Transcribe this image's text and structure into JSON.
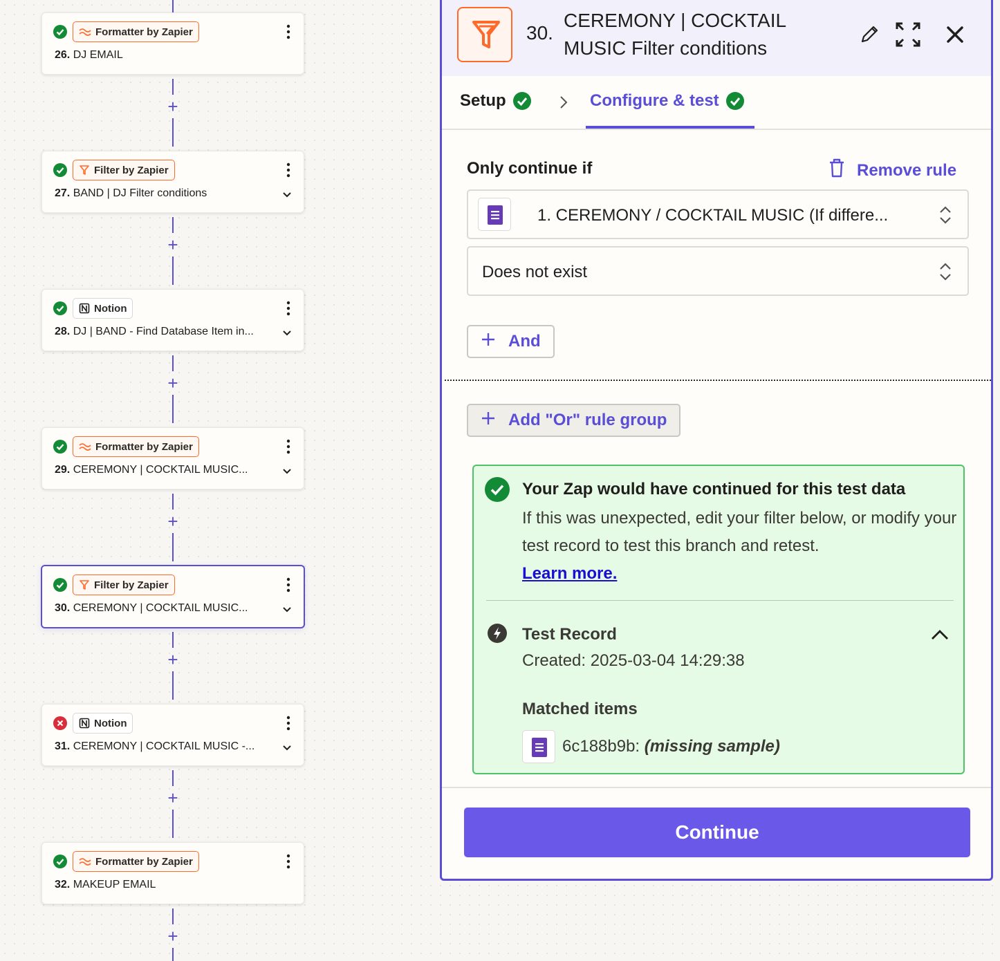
{
  "steps": [
    {
      "num": "26.",
      "title": "DJ EMAIL",
      "app": "Formatter by Zapier",
      "app_type": "formatter",
      "status": "ok",
      "expandable": false,
      "selected": false
    },
    {
      "num": "27.",
      "title": "BAND | DJ Filter conditions",
      "app": "Filter by Zapier",
      "app_type": "filter",
      "status": "ok",
      "expandable": true,
      "selected": false
    },
    {
      "num": "28.",
      "title": "DJ | BAND - Find Database Item in...",
      "app": "Notion",
      "app_type": "notion",
      "status": "ok",
      "expandable": true,
      "selected": false
    },
    {
      "num": "29.",
      "title": "CEREMONY | COCKTAIL MUSIC...",
      "app": "Formatter by Zapier",
      "app_type": "formatter",
      "status": "ok",
      "expandable": true,
      "selected": false
    },
    {
      "num": "30.",
      "title": "CEREMONY | COCKTAIL MUSIC...",
      "app": "Filter by Zapier",
      "app_type": "filter",
      "status": "ok",
      "expandable": true,
      "selected": true
    },
    {
      "num": "31.",
      "title": "CEREMONY | COCKTAIL MUSIC -...",
      "app": "Notion",
      "app_type": "notion",
      "status": "error",
      "expandable": true,
      "selected": false
    },
    {
      "num": "32.",
      "title": "MAKEUP EMAIL",
      "app": "Formatter by Zapier",
      "app_type": "formatter",
      "status": "ok",
      "expandable": false,
      "selected": false
    }
  ],
  "add_step_label": "+",
  "panel": {
    "step_num": "30.",
    "step_name": "CEREMONY | COCKTAIL MUSIC Filter conditions",
    "icons": {
      "edit": "pencil-icon",
      "expand": "expand-icon",
      "close": "close-icon"
    },
    "tabs": [
      {
        "label": "Setup",
        "done": true,
        "active": false
      },
      {
        "label": "Configure & test",
        "done": true,
        "active": true
      }
    ],
    "rule_heading": "Only continue if",
    "remove_rule_label": "Remove rule",
    "field_value": "1. CEREMONY / COCKTAIL MUSIC (If differe...",
    "condition_value": "Does not exist",
    "and_label": "And",
    "or_group_label": "Add \"Or\" rule group",
    "result": {
      "title": "Your Zap would have continued for this test data",
      "body": "If this was unexpected, edit your filter below, or modify your test record to test this branch and retest.",
      "link": "Learn more.",
      "test_record_title": "Test Record",
      "created": "Created: 2025-03-04 14:29:38",
      "matched_title": "Matched items",
      "matched_id": "6c188b9b:",
      "matched_value": "(missing sample)"
    },
    "continue_label": "Continue"
  },
  "colors": {
    "accent": "#5a4dd6",
    "button": "#6a59e8",
    "success": "#138a36",
    "error": "#d92d3a",
    "filter_orange": "#ff6a2b",
    "result_bg": "#e6fbe6"
  }
}
